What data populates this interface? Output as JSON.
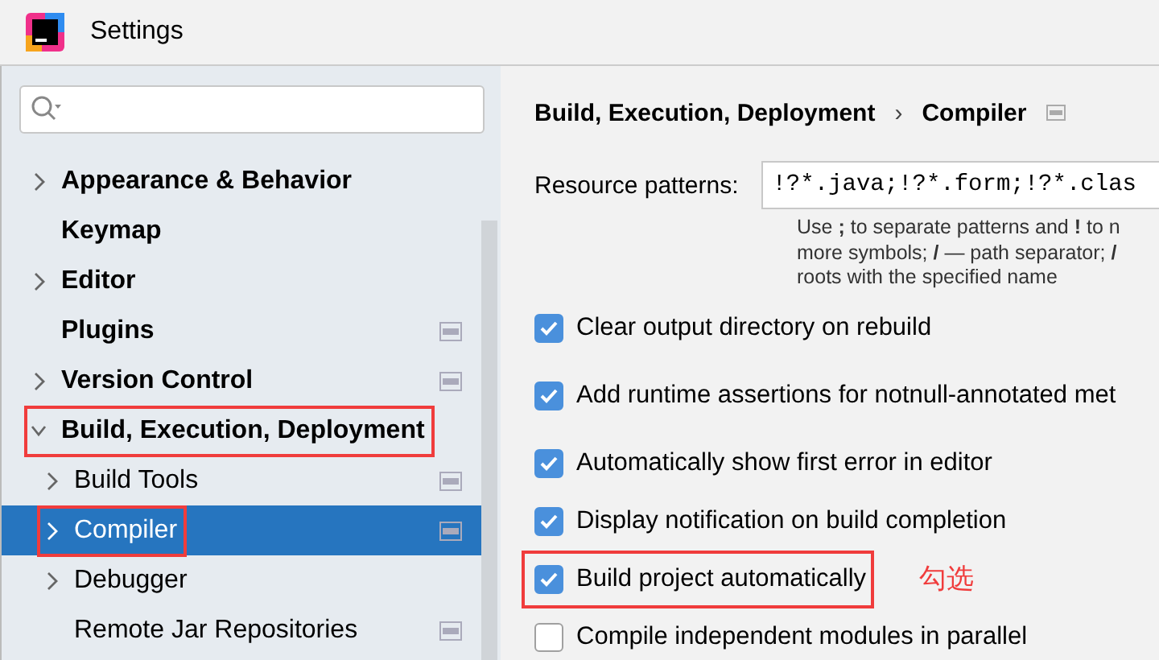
{
  "window": {
    "title": "Settings"
  },
  "sidebar": {
    "items": [
      {
        "label": "Appearance & Behavior",
        "expandable": true,
        "expanded": false,
        "highlighted": false,
        "badge": false
      },
      {
        "label": "Keymap",
        "expandable": false,
        "highlighted": false,
        "badge": false
      },
      {
        "label": "Editor",
        "expandable": true,
        "expanded": false,
        "highlighted": false,
        "badge": false
      },
      {
        "label": "Plugins",
        "expandable": false,
        "highlighted": false,
        "badge": true
      },
      {
        "label": "Version Control",
        "expandable": true,
        "expanded": false,
        "highlighted": false,
        "badge": true
      },
      {
        "label": "Build, Execution, Deployment",
        "expandable": true,
        "expanded": true,
        "highlighted": true,
        "badge": false,
        "children": [
          {
            "label": "Build Tools",
            "expandable": true,
            "selected": false,
            "highlighted": false,
            "badge": true
          },
          {
            "label": "Compiler",
            "expandable": true,
            "selected": true,
            "highlighted": true,
            "badge": true
          },
          {
            "label": "Debugger",
            "expandable": true,
            "selected": false,
            "highlighted": false,
            "badge": false
          },
          {
            "label": "Remote Jar Repositories",
            "expandable": false,
            "selected": false,
            "highlighted": false,
            "badge": true
          }
        ]
      }
    ]
  },
  "breadcrumb": {
    "parent": "Build, Execution, Deployment",
    "separator": "›",
    "current": "Compiler"
  },
  "resource_patterns": {
    "label": "Resource patterns:",
    "value": "!?*.java;!?*.form;!?*.clas",
    "hint": [
      "Use **;** to separate patterns and **!** to n",
      "more symbols; **/** — path separator; **/**",
      "roots with the specified name"
    ]
  },
  "options": [
    {
      "label": "Clear output directory on rebuild",
      "checked": true,
      "highlighted": false
    },
    {
      "label": "Add runtime assertions for notnull-annotated met",
      "checked": true,
      "highlighted": false
    },
    {
      "label": "Automatically show first error in editor",
      "checked": true,
      "highlighted": false
    },
    {
      "label": "Display notification on build completion",
      "checked": true,
      "highlighted": false
    },
    {
      "label": "Build project automatically",
      "checked": true,
      "highlighted": true
    },
    {
      "label": "Compile independent modules in parallel",
      "checked": false,
      "highlighted": false
    }
  ],
  "annotation": {
    "text": "勾选"
  }
}
